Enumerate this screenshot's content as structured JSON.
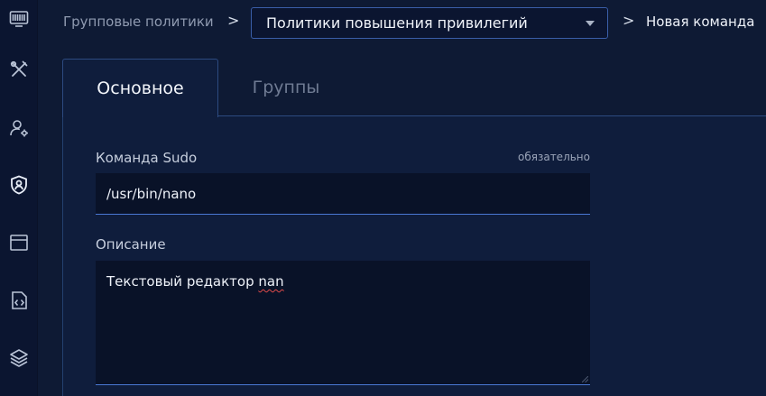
{
  "header": {
    "breadcrumb_parent": "Групповые политики",
    "separator": ">",
    "select_value": "Политики повышения привилегий",
    "breadcrumb_current": "Новая команда"
  },
  "sidebar": {
    "items": [
      {
        "icon": "monitor-icon",
        "active": false
      },
      {
        "icon": "tools-icon",
        "active": false
      },
      {
        "icon": "user-settings-icon",
        "active": false
      },
      {
        "icon": "user-shield-icon",
        "active": true
      },
      {
        "icon": "window-icon",
        "active": false
      },
      {
        "icon": "code-file-icon",
        "active": false
      },
      {
        "icon": "layers-icon",
        "active": false
      }
    ]
  },
  "tabs": [
    {
      "label": "Основное",
      "active": true
    },
    {
      "label": "Группы",
      "active": false
    }
  ],
  "form": {
    "command_label": "Команда Sudo",
    "required_hint": "обязательно",
    "command_value": "/usr/bin/nano",
    "description_label": "Описание",
    "description_prefix": "Текстовый редактор ",
    "description_misspelled": "nan"
  },
  "colors": {
    "background": "#0e1a34",
    "accent_border": "#3a5ea8",
    "input_underline": "#4a78d4",
    "spellcheck": "#e04a4a"
  }
}
